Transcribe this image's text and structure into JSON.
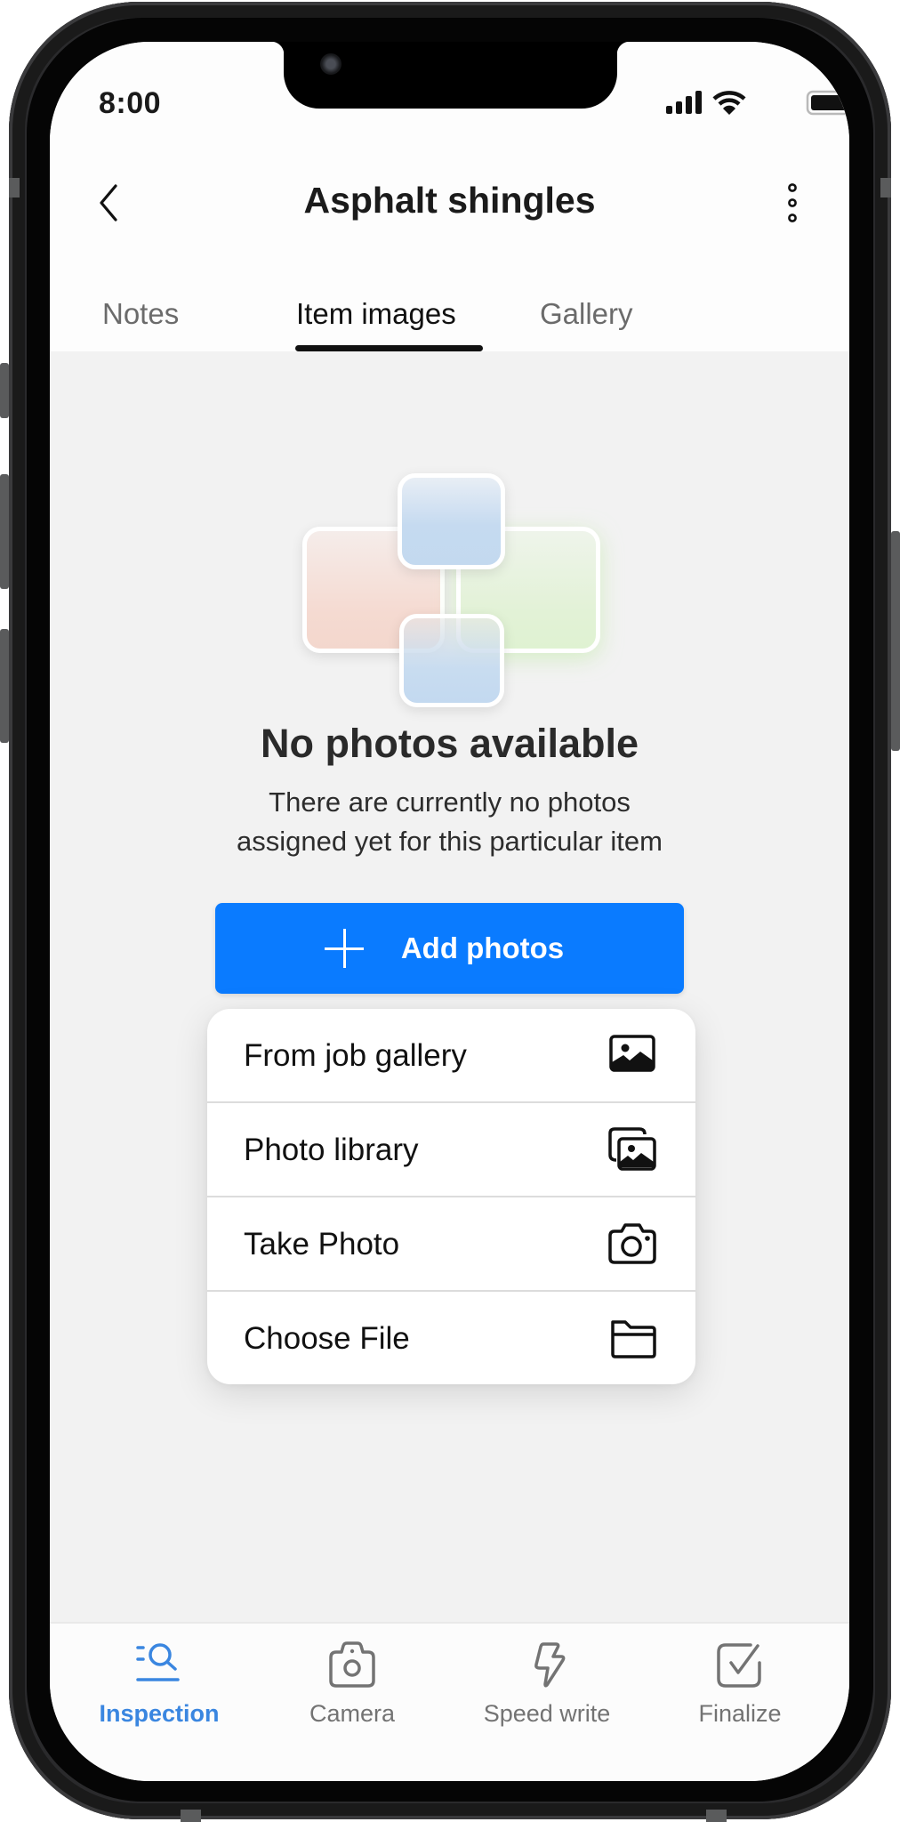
{
  "status_bar": {
    "time": "8:00",
    "icons": [
      "cellular-signal-icon",
      "wifi-icon",
      "battery-icon"
    ]
  },
  "nav": {
    "back_icon": "chevron-left-icon",
    "title": "Asphalt shingles",
    "more_icon": "vertical-ellipsis-icon"
  },
  "tabs": [
    {
      "label": "Notes",
      "active": false
    },
    {
      "label": "Item images",
      "active": true
    },
    {
      "label": "Gallery",
      "active": false
    }
  ],
  "empty_state": {
    "illustration": "stacked-photo-placeholders",
    "title": "No photos available",
    "subtitle_line1": "There are currently no photos",
    "subtitle_line2": "assigned yet for this particular item"
  },
  "add_button": {
    "icon": "plus-icon",
    "label": "Add photos",
    "color": "#0A7BFF"
  },
  "add_menu": {
    "items": [
      {
        "label": "From job gallery",
        "icon": "image-icon"
      },
      {
        "label": "Photo library",
        "icon": "photo-stack-icon"
      },
      {
        "label": "Take Photo",
        "icon": "camera-icon"
      },
      {
        "label": "Choose File",
        "icon": "folder-icon"
      }
    ]
  },
  "tab_bar": {
    "active_color": "#3A86E0",
    "inactive_color": "#737373",
    "items": [
      {
        "label": "Inspection",
        "icon": "inspection-search-icon",
        "active": true
      },
      {
        "label": "Camera",
        "icon": "camera-icon",
        "active": false
      },
      {
        "label": "Speed write",
        "icon": "lightning-icon",
        "active": false
      },
      {
        "label": "Finalize",
        "icon": "checkbox-icon",
        "active": false
      }
    ]
  }
}
